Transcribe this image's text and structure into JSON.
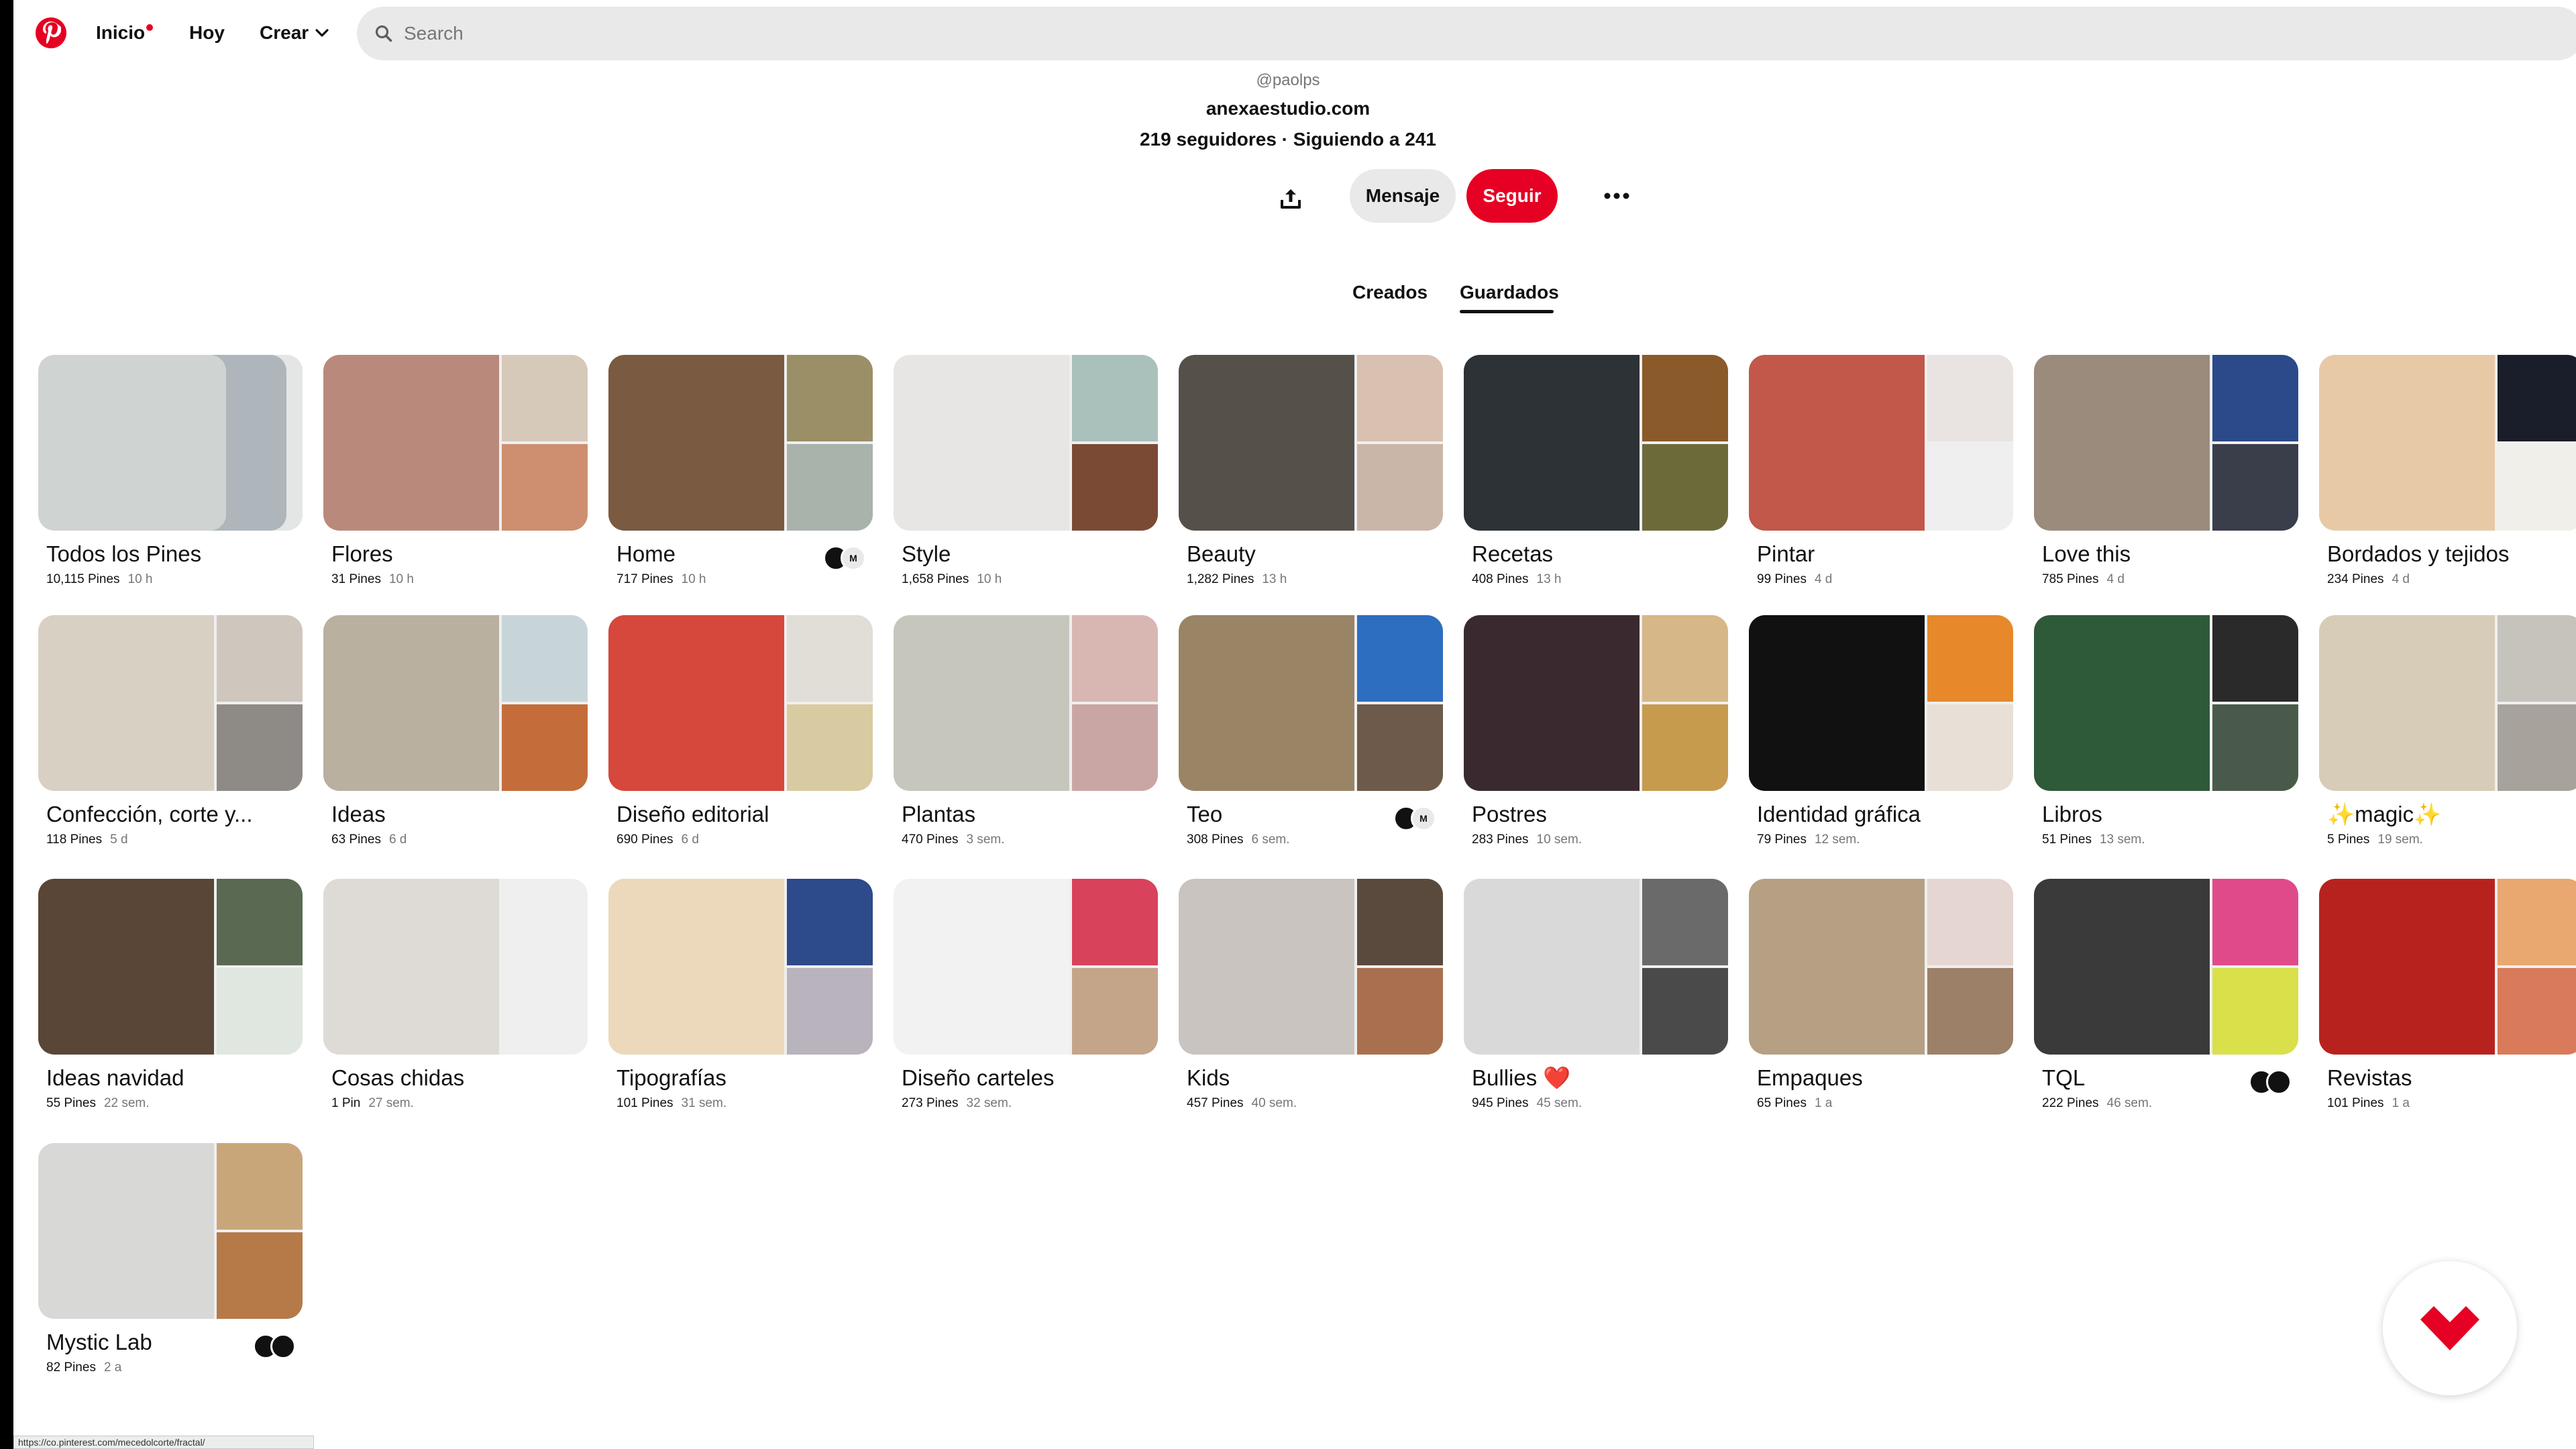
{
  "nav": {
    "inicio": "Inicio",
    "hoy": "Hoy",
    "crear": "Crear",
    "search_placeholder": "Search",
    "brand_color": "#e60023"
  },
  "profile": {
    "handle": "@paolps",
    "website": "anexaestudio.com",
    "followers": "219 seguidores",
    "separator": " · ",
    "following": "Siguiendo a 241",
    "message_label": "Mensaje",
    "follow_label": "Seguir"
  },
  "tabs": {
    "created": "Creados",
    "saved": "Guardados"
  },
  "boards": [
    {
      "title": "Todos los Pines",
      "count": "10,115 Pines",
      "time": "10 h",
      "colors": [
        "#cfd3d2",
        "#aeb5bb",
        "#e4e6e6"
      ]
    },
    {
      "title": "Flores",
      "count": "31 Pines",
      "time": "10 h",
      "colors": [
        "#b98a7c",
        "#d6c9b9",
        "#cd8f6f"
      ]
    },
    {
      "title": "Home",
      "count": "717 Pines",
      "time": "10 h",
      "colors": [
        "#7a5a40",
        "#9a8f67",
        "#a9b2ab"
      ],
      "collab": [
        "",
        "M"
      ]
    },
    {
      "title": "Style",
      "count": "1,658 Pines",
      "time": "10 h",
      "colors": [
        "#e8e6e4",
        "#aac0bb",
        "#7a4a34"
      ]
    },
    {
      "title": "Beauty",
      "count": "1,282 Pines",
      "time": "13 h",
      "colors": [
        "#55504a",
        "#d8c1b0",
        "#c9b6a8"
      ]
    },
    {
      "title": "Recetas",
      "count": "408 Pines",
      "time": "13 h",
      "colors": [
        "#2c3236",
        "#8a5a2a",
        "#6d6a3a"
      ]
    },
    {
      "title": "Pintar",
      "count": "99 Pines",
      "time": "4 d",
      "colors": [
        "#c2584a",
        "#e9e3e1",
        "#efefef"
      ]
    },
    {
      "title": "Love this",
      "count": "785 Pines",
      "time": "4 d",
      "colors": [
        "#9a8b7c",
        "#2c4a8a",
        "#3a3e4a"
      ]
    },
    {
      "title": "Bordados y tejidos",
      "count": "234 Pines",
      "time": "4 d",
      "colors": [
        "#e8c9a6",
        "#1a1e2a",
        "#f1efe9"
      ]
    },
    {
      "title": "Confección, corte y...",
      "count": "118 Pines",
      "time": "5 d",
      "colors": [
        "#d9d0c4",
        "#cfc6bd",
        "#8e8a86"
      ]
    },
    {
      "title": "Ideas",
      "count": "63 Pines",
      "time": "6 d",
      "colors": [
        "#b9b0a0",
        "#c8d5d8",
        "#c46d3a"
      ]
    },
    {
      "title": "Diseño editorial",
      "count": "690 Pines",
      "time": "6 d",
      "colors": [
        "#d6473c",
        "#e1ddd7",
        "#d9cba1"
      ]
    },
    {
      "title": "Plantas",
      "count": "470 Pines",
      "time": "3 sem.",
      "colors": [
        "#c7c6bd",
        "#d8b7b2",
        "#c9a6a4"
      ]
    },
    {
      "title": "Teo",
      "count": "308 Pines",
      "time": "6 sem.",
      "colors": [
        "#9a8466",
        "#2d6ec0",
        "#6d5a4a"
      ],
      "collab": [
        "",
        "M"
      ]
    },
    {
      "title": "Postres",
      "count": "283 Pines",
      "time": "10 sem.",
      "colors": [
        "#3a2a30",
        "#d6b787",
        "#c79b4e"
      ]
    },
    {
      "title": "Identidad gráfica",
      "count": "79 Pines",
      "time": "12 sem.",
      "colors": [
        "#111111",
        "#e7892a",
        "#e8e0d6"
      ]
    },
    {
      "title": "Libros",
      "count": "51 Pines",
      "time": "13 sem.",
      "colors": [
        "#2e5a3a",
        "#2a2a2a",
        "#4a5a4a"
      ]
    },
    {
      "title": "✨magic✨",
      "count": "5 Pines",
      "time": "19 sem.",
      "colors": [
        "#d7ccb8",
        "#c6c3bd",
        "#a7a29b"
      ]
    },
    {
      "title": "Ideas navidad",
      "count": "55 Pines",
      "time": "22 sem.",
      "colors": [
        "#5a4636",
        "#5a6a52",
        "#e0e6e0"
      ]
    },
    {
      "title": "Cosas chidas",
      "count": "1 Pin",
      "time": "27 sem.",
      "colors": [
        "#dedad6",
        "#efefef",
        "#efefef"
      ]
    },
    {
      "title": "Tipografías",
      "count": "101 Pines",
      "time": "31 sem.",
      "colors": [
        "#ecd9bb",
        "#2d4a8a",
        "#b9b3bd"
      ]
    },
    {
      "title": "Diseño carteles",
      "count": "273 Pines",
      "time": "32 sem.",
      "colors": [
        "#f2f2f2",
        "#d8425a",
        "#c4a58a"
      ]
    },
    {
      "title": "Kids",
      "count": "457 Pines",
      "time": "40 sem.",
      "colors": [
        "#c9c4c0",
        "#5a4a3e",
        "#a8704e"
      ]
    },
    {
      "title": "Bullies ❤️",
      "count": "945 Pines",
      "time": "45 sem.",
      "colors": [
        "#d9d9d9",
        "#6a6a6a",
        "#4a4a4a"
      ]
    },
    {
      "title": "Empaques",
      "count": "65 Pines",
      "time": "1 a",
      "colors": [
        "#b6a084",
        "#e6d6d2",
        "#9c8068"
      ]
    },
    {
      "title": "TQL",
      "count": "222 Pines",
      "time": "46 sem.",
      "colors": [
        "#3a3a3a",
        "#e04a8a",
        "#d9e04a"
      ],
      "collab": [
        "",
        ""
      ]
    },
    {
      "title": "Revistas",
      "count": "101 Pines",
      "time": "1 a",
      "colors": [
        "#b8221e",
        "#e8a870",
        "#d97a5a"
      ]
    },
    {
      "title": "Mystic Lab",
      "count": "82 Pines",
      "time": "2 a",
      "colors": [
        "#d8d8d6",
        "#c9a67a",
        "#b57a48"
      ],
      "collab": [
        "",
        ""
      ]
    }
  ],
  "status_url": "https://co.pinterest.com/mecedolcorte/fractal/",
  "icons": {
    "logo": "pinterest-logo-icon",
    "search": "search-icon",
    "chevron": "chevron-down-icon",
    "share": "share-icon",
    "more": "more-options-icon",
    "float": "domestika-logo-icon"
  }
}
